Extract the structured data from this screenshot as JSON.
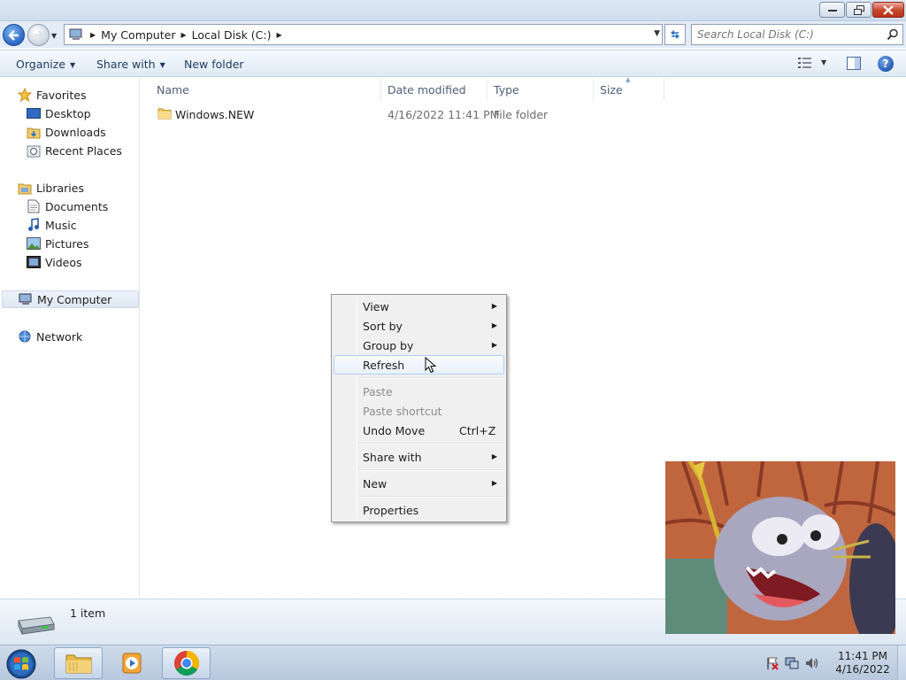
{
  "titlebar": {
    "min_icon": "minimize-icon",
    "max_icon": "restore-icon",
    "close_icon": "close-icon"
  },
  "address": {
    "crumbs": [
      "My Computer",
      "Local Disk (C:)"
    ],
    "search_placeholder": "Search Local Disk (C:)"
  },
  "toolbar": {
    "organize": "Organize",
    "share_with": "Share with",
    "new_folder": "New folder",
    "help": "?"
  },
  "nav": {
    "favorites": "Favorites",
    "desktop": "Desktop",
    "downloads": "Downloads",
    "recent_places": "Recent Places",
    "libraries": "Libraries",
    "documents": "Documents",
    "music": "Music",
    "pictures": "Pictures",
    "videos": "Videos",
    "my_computer": "My Computer",
    "network": "Network"
  },
  "columns": {
    "name": "Name",
    "date": "Date modified",
    "type": "Type",
    "size": "Size"
  },
  "files": [
    {
      "name": "Windows.NEW",
      "date": "4/16/2022 11:41 PM",
      "type": "File folder"
    }
  ],
  "context_menu": {
    "view": "View",
    "sort_by": "Sort by",
    "group_by": "Group by",
    "refresh": "Refresh",
    "paste": "Paste",
    "paste_shortcut": "Paste shortcut",
    "undo_move": "Undo Move",
    "undo_shortcut": "Ctrl+Z",
    "share_with": "Share with",
    "new": "New",
    "properties": "Properties"
  },
  "status": {
    "item_count": "1 item"
  },
  "taskbar": {
    "time": "11:41 PM",
    "date": "4/16/2022"
  },
  "colors": {
    "accent": "#2a67c4",
    "menu_hover_border": "#aecff7",
    "disabled_text": "#8d8d8d"
  }
}
